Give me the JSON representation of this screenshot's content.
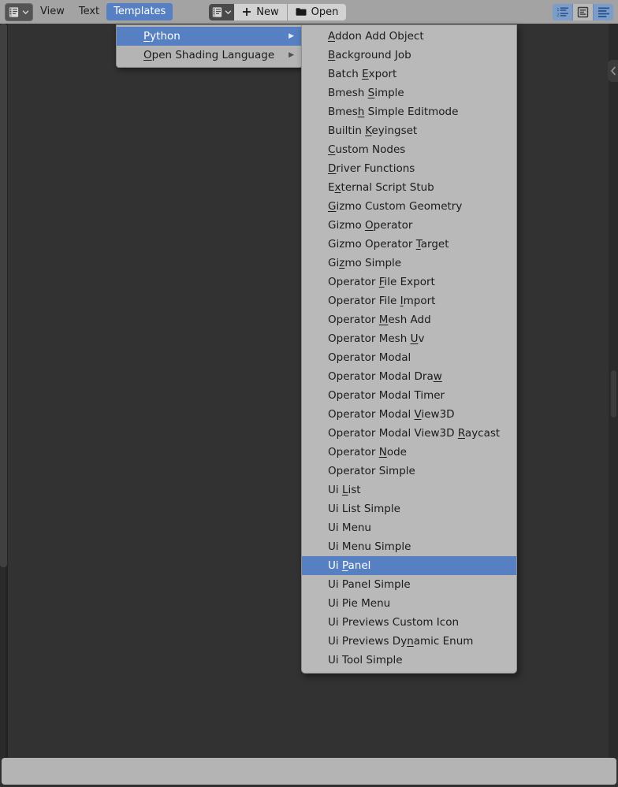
{
  "header": {
    "editor_type_selector": {
      "icon": "text-editor-icon",
      "chevron": "chevron-down-icon"
    },
    "menus": [
      {
        "label": "View",
        "active": false
      },
      {
        "label": "Text",
        "active": false
      },
      {
        "label": "Templates",
        "active": true
      }
    ],
    "datablock_selector": {
      "icon": "text-datablock-icon",
      "chevron": "chevron-down-icon"
    },
    "new_button": {
      "label": "New",
      "icon": "plus-icon"
    },
    "open_button": {
      "label": "Open",
      "icon": "folder-icon"
    },
    "toggles": [
      {
        "name": "line-numbers-toggle",
        "enabled": true
      },
      {
        "name": "word-wrap-toggle",
        "enabled": false
      },
      {
        "name": "syntax-highlight-toggle",
        "enabled": true
      }
    ]
  },
  "sidebar_tab": {
    "icon": "chevron-left-icon"
  },
  "templates_menu": {
    "items": [
      {
        "label": "Python",
        "acc_index": 0,
        "submenu": true,
        "active": true
      },
      {
        "label": "Open Shading Language",
        "acc_index": 0,
        "submenu": true,
        "active": false
      }
    ],
    "submenu_arrow": "▶"
  },
  "python_templates": {
    "items": [
      {
        "label": "Addon Add Object",
        "acc_index": 0,
        "active": false
      },
      {
        "label": "Background Job",
        "acc_index": 0,
        "active": false
      },
      {
        "label": "Batch Export",
        "acc_index": 6,
        "active": false
      },
      {
        "label": "Bmesh Simple",
        "acc_index": 6,
        "active": false
      },
      {
        "label": "Bmesh Simple Editmode",
        "acc_index": 4,
        "active": false
      },
      {
        "label": "Builtin Keyingset",
        "acc_index": 8,
        "active": false
      },
      {
        "label": "Custom Nodes",
        "acc_index": 0,
        "active": false
      },
      {
        "label": "Driver Functions",
        "acc_index": 0,
        "active": false
      },
      {
        "label": "External Script Stub",
        "acc_index": 1,
        "active": false
      },
      {
        "label": "Gizmo Custom Geometry",
        "acc_index": 0,
        "active": false
      },
      {
        "label": "Gizmo Operator",
        "acc_index": 6,
        "active": false
      },
      {
        "label": "Gizmo Operator Target",
        "acc_index": 15,
        "active": false
      },
      {
        "label": "Gizmo Simple",
        "acc_index": 2,
        "active": false
      },
      {
        "label": "Operator File Export",
        "acc_index": 9,
        "active": false
      },
      {
        "label": "Operator File Import",
        "acc_index": 14,
        "active": false
      },
      {
        "label": "Operator Mesh Add",
        "acc_index": 9,
        "active": false
      },
      {
        "label": "Operator Mesh Uv",
        "acc_index": 14,
        "active": false
      },
      {
        "label": "Operator Modal",
        "acc_index": -1,
        "active": false
      },
      {
        "label": "Operator Modal Draw",
        "acc_index": 18,
        "active": false
      },
      {
        "label": "Operator Modal Timer",
        "acc_index": -1,
        "active": false
      },
      {
        "label": "Operator Modal View3D",
        "acc_index": 15,
        "active": false
      },
      {
        "label": "Operator Modal View3D Raycast",
        "acc_index": 22,
        "active": false
      },
      {
        "label": "Operator Node",
        "acc_index": 9,
        "active": false
      },
      {
        "label": "Operator Simple",
        "acc_index": -1,
        "active": false
      },
      {
        "label": "Ui List",
        "acc_index": 3,
        "active": false
      },
      {
        "label": "Ui List Simple",
        "acc_index": -1,
        "active": false
      },
      {
        "label": "Ui Menu",
        "acc_index": -1,
        "active": false
      },
      {
        "label": "Ui Menu Simple",
        "acc_index": -1,
        "active": false
      },
      {
        "label": "Ui Panel",
        "acc_index": 3,
        "active": true
      },
      {
        "label": "Ui Panel Simple",
        "acc_index": -1,
        "active": false
      },
      {
        "label": "Ui Pie Menu",
        "acc_index": -1,
        "active": false
      },
      {
        "label": "Ui Previews Custom Icon",
        "acc_index": -1,
        "active": false
      },
      {
        "label": "Ui Previews Dynamic Enum",
        "acc_index": 14,
        "active": false
      },
      {
        "label": "Ui Tool Simple",
        "acc_index": -1,
        "active": false
      }
    ]
  },
  "colors": {
    "accent_blue": "#5680c2",
    "header_gray": "#a3a3a3",
    "menu_gray": "#b9b9b9",
    "editor_bg": "#323232",
    "status_bar": "#b4b4b4"
  }
}
